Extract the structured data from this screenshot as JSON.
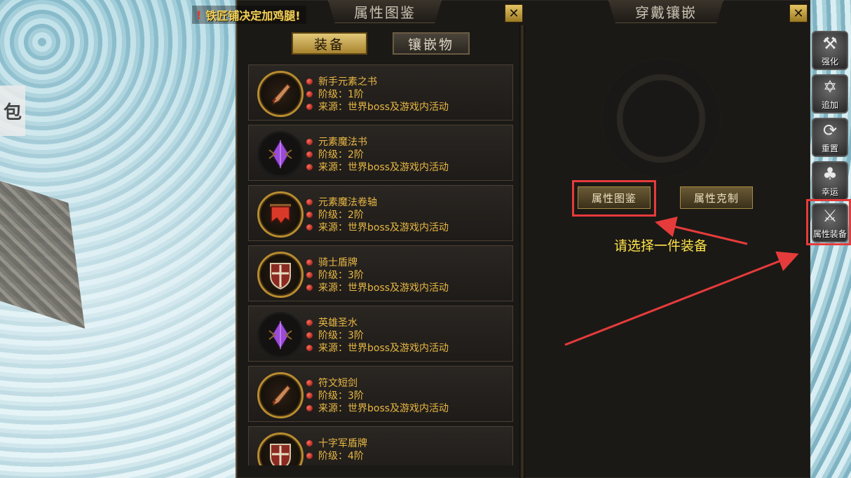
{
  "system_message": {
    "icon": "!",
    "text": "铁匠铺决定加鸡腿!"
  },
  "background": {
    "left_tab_label": "包"
  },
  "panel": {
    "left_title": "属性图鉴",
    "right_title": "穿戴镶嵌",
    "close_glyph": "✕",
    "tabs": [
      {
        "label": "装备",
        "active": true
      },
      {
        "label": "镶嵌物",
        "active": false
      }
    ],
    "items": [
      {
        "name": "新手元素之书",
        "level": "阶级：1阶",
        "source": "来源：世界boss及游戏内活动",
        "icon": "dagger-icon"
      },
      {
        "name": "元素魔法书",
        "level": "阶级：2阶",
        "source": "来源：世界boss及游戏内活动",
        "icon": "purple-crystal-icon"
      },
      {
        "name": "元素魔法卷轴",
        "level": "阶级：2阶",
        "source": "来源：世界boss及游戏内活动",
        "icon": "red-banner-icon"
      },
      {
        "name": "骑士盾牌",
        "level": "阶级：3阶",
        "source": "来源：世界boss及游戏内活动",
        "icon": "shield-icon"
      },
      {
        "name": "英雄圣水",
        "level": "阶级：3阶",
        "source": "来源：世界boss及游戏内活动",
        "icon": "purple-crystal-icon"
      },
      {
        "name": "符文短剑",
        "level": "阶级：3阶",
        "source": "来源：世界boss及游戏内活动",
        "icon": "dagger-icon"
      },
      {
        "name": "十字军盾牌",
        "level": "阶级：4阶",
        "source": "",
        "icon": "shield-icon"
      }
    ],
    "right": {
      "codex_button": "属性图鉴",
      "counter_button": "属性克制",
      "hint": "请选择一件装备"
    }
  },
  "sidebar": [
    {
      "label": "强化",
      "icon": "anvil-icon",
      "glyph": "⚒"
    },
    {
      "label": "追加",
      "icon": "star-icon",
      "glyph": "✡"
    },
    {
      "label": "重置",
      "icon": "refresh-icon",
      "glyph": "⟳"
    },
    {
      "label": "幸运",
      "icon": "clover-icon",
      "glyph": "♣"
    },
    {
      "label": "属性装备",
      "icon": "helmet-swords-icon",
      "glyph": "⚔"
    }
  ],
  "colors": {
    "accent_gold": "#e8b844",
    "highlight_red": "#e63b3b",
    "hint_yellow": "#ffe34a"
  }
}
